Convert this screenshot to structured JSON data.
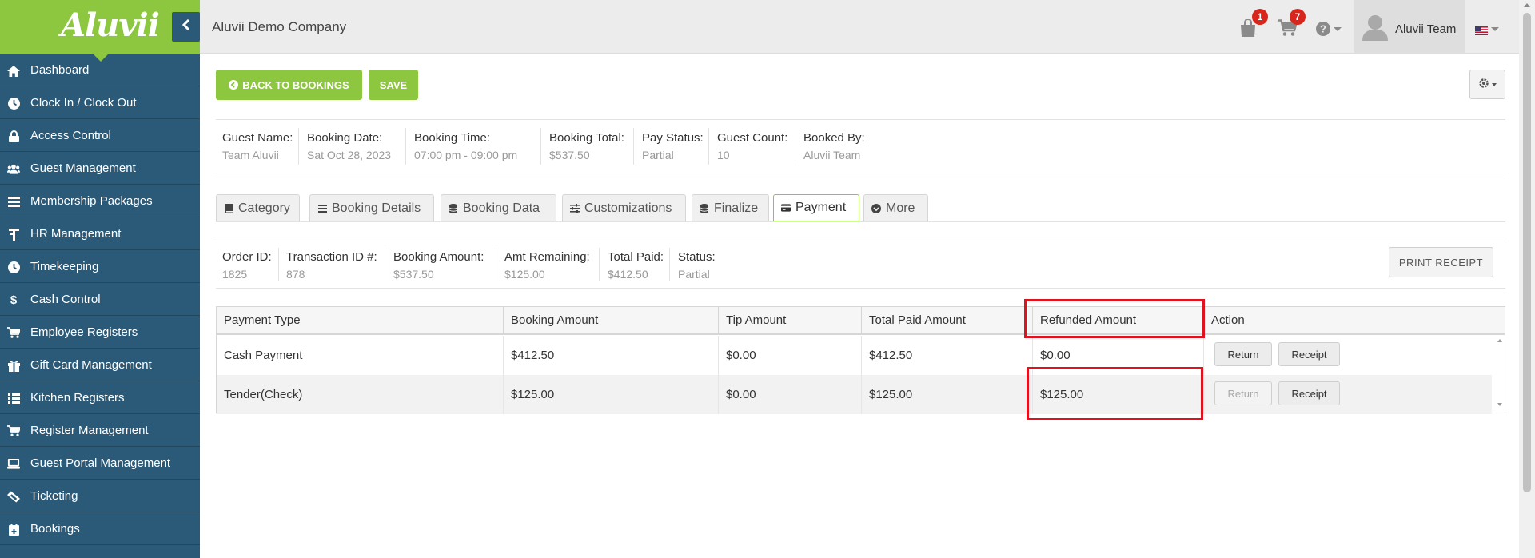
{
  "app": {
    "logo_text": "Aluvii",
    "company_name": "Aluvii Demo Company"
  },
  "sidebar": {
    "items": [
      {
        "label": "Dashboard",
        "icon": "home-icon"
      },
      {
        "label": "Clock In / Clock Out",
        "icon": "clock-icon"
      },
      {
        "label": "Access Control",
        "icon": "lock-icon"
      },
      {
        "label": "Guest Management",
        "icon": "users-icon"
      },
      {
        "label": "Membership Packages",
        "icon": "list-icon"
      },
      {
        "label": "HR Management",
        "icon": "hr-icon"
      },
      {
        "label": "Timekeeping",
        "icon": "clock-icon"
      },
      {
        "label": "Cash Control",
        "icon": "dollar-icon"
      },
      {
        "label": "Employee Registers",
        "icon": "cart-icon"
      },
      {
        "label": "Gift Card Management",
        "icon": "gift-icon"
      },
      {
        "label": "Kitchen Registers",
        "icon": "list-icon"
      },
      {
        "label": "Register Management",
        "icon": "cart-icon"
      },
      {
        "label": "Guest Portal Management",
        "icon": "laptop-icon"
      },
      {
        "label": "Ticketing",
        "icon": "ticket-icon"
      },
      {
        "label": "Bookings",
        "icon": "calendar-icon"
      }
    ]
  },
  "topbar": {
    "bag_badge": "1",
    "cart_badge": "7",
    "user_name": "Aluvii Team"
  },
  "toolbar": {
    "back_label": "BACK TO BOOKINGS",
    "save_label": "SAVE"
  },
  "booking": [
    {
      "label": "Guest Name:",
      "value": "Team Aluvii"
    },
    {
      "label": "Booking Date:",
      "value": "Sat Oct 28, 2023"
    },
    {
      "label": "Booking Time:",
      "value": "07:00 pm - 09:00 pm"
    },
    {
      "label": "Booking Total:",
      "value": "$537.50"
    },
    {
      "label": "Pay Status:",
      "value": "Partial"
    },
    {
      "label": "Guest Count:",
      "value": "10"
    },
    {
      "label": "Booked By:",
      "value": "Aluvii Team"
    }
  ],
  "tabs": [
    {
      "label": "Category",
      "icon": "book-icon",
      "active": false
    },
    {
      "label": "Booking Details",
      "icon": "list-icon",
      "active": false
    },
    {
      "label": "Booking Data",
      "icon": "database-icon",
      "active": false
    },
    {
      "label": "Customizations",
      "icon": "sliders-icon",
      "active": false
    },
    {
      "label": "Finalize",
      "icon": "database-icon",
      "active": false
    },
    {
      "label": "Payment",
      "icon": "credit-card-icon",
      "active": true
    },
    {
      "label": "More",
      "icon": "chevron-circle-down-icon",
      "active": false
    }
  ],
  "payment_info": [
    {
      "label": "Order ID:",
      "value": "1825"
    },
    {
      "label": "Transaction ID #:",
      "value": "878"
    },
    {
      "label": "Booking Amount:",
      "value": "$537.50"
    },
    {
      "label": "Amt Remaining:",
      "value": "$125.00"
    },
    {
      "label": "Total Paid:",
      "value": "$412.50"
    },
    {
      "label": "Status:",
      "value": "Partial"
    }
  ],
  "print_receipt_label": "PRINT RECEIPT",
  "table": {
    "headers": [
      "Payment Type",
      "Booking Amount",
      "Tip Amount",
      "Total Paid Amount",
      "Refunded Amount",
      "Action"
    ],
    "rows": [
      {
        "type": "Cash Payment",
        "booking": "$412.50",
        "tip": "$0.00",
        "total": "$412.50",
        "refunded": "$0.00",
        "return_label": "Return",
        "return_enabled": true,
        "receipt_label": "Receipt"
      },
      {
        "type": "Tender(Check)",
        "booking": "$125.00",
        "tip": "$0.00",
        "total": "$125.00",
        "refunded": "$125.00",
        "return_label": "Return",
        "return_enabled": false,
        "receipt_label": "Receipt"
      }
    ]
  },
  "colors": {
    "brand_green": "#8dc63f",
    "sidebar_blue": "#2b5a78",
    "badge_red": "#d9261c",
    "highlight_red": "#e0121e"
  }
}
